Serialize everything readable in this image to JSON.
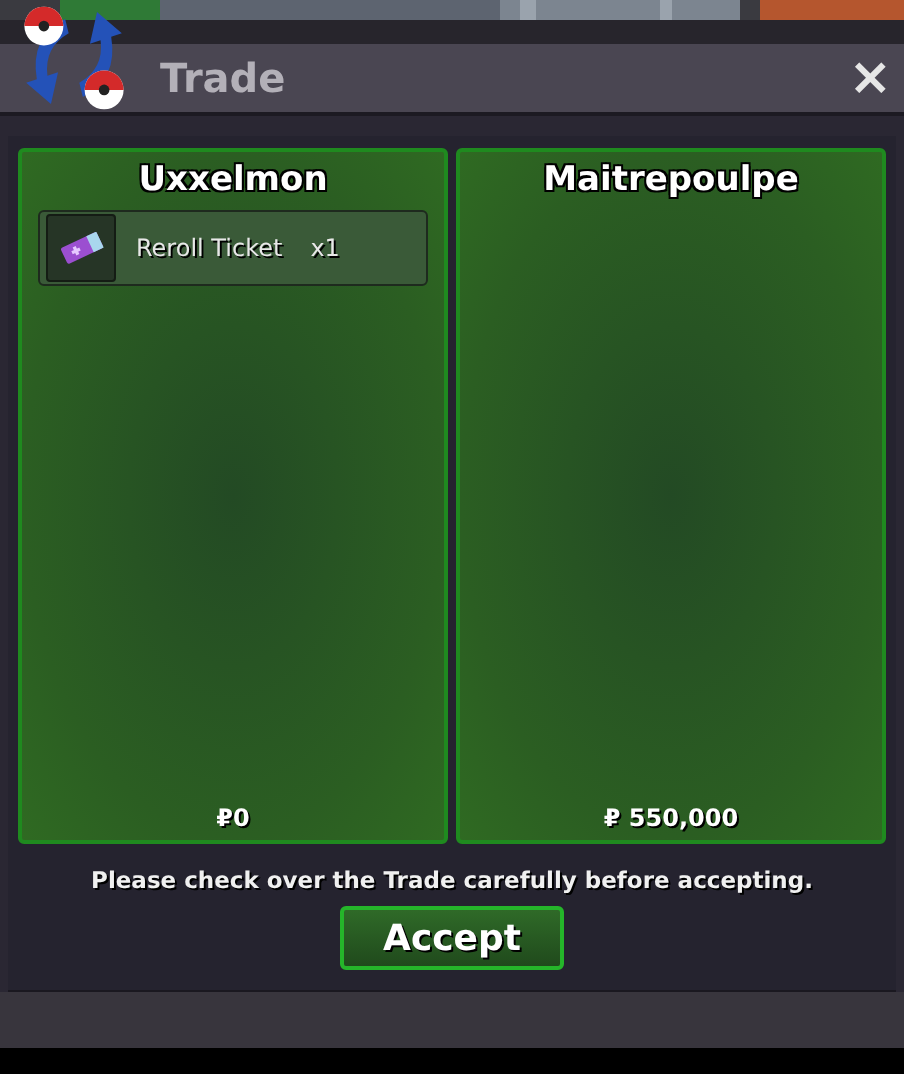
{
  "window": {
    "title": "Trade",
    "close": "×"
  },
  "panels": [
    {
      "name": "Uxxelmon",
      "items": [
        {
          "name": "Reroll Ticket",
          "quantity": "x1"
        }
      ],
      "money": "₽0"
    },
    {
      "name": "Maitrepoulpe",
      "money": "₽ 550,000"
    }
  ],
  "notice": "Please check over the Trade carefully before accepting.",
  "accept_button": "Accept"
}
